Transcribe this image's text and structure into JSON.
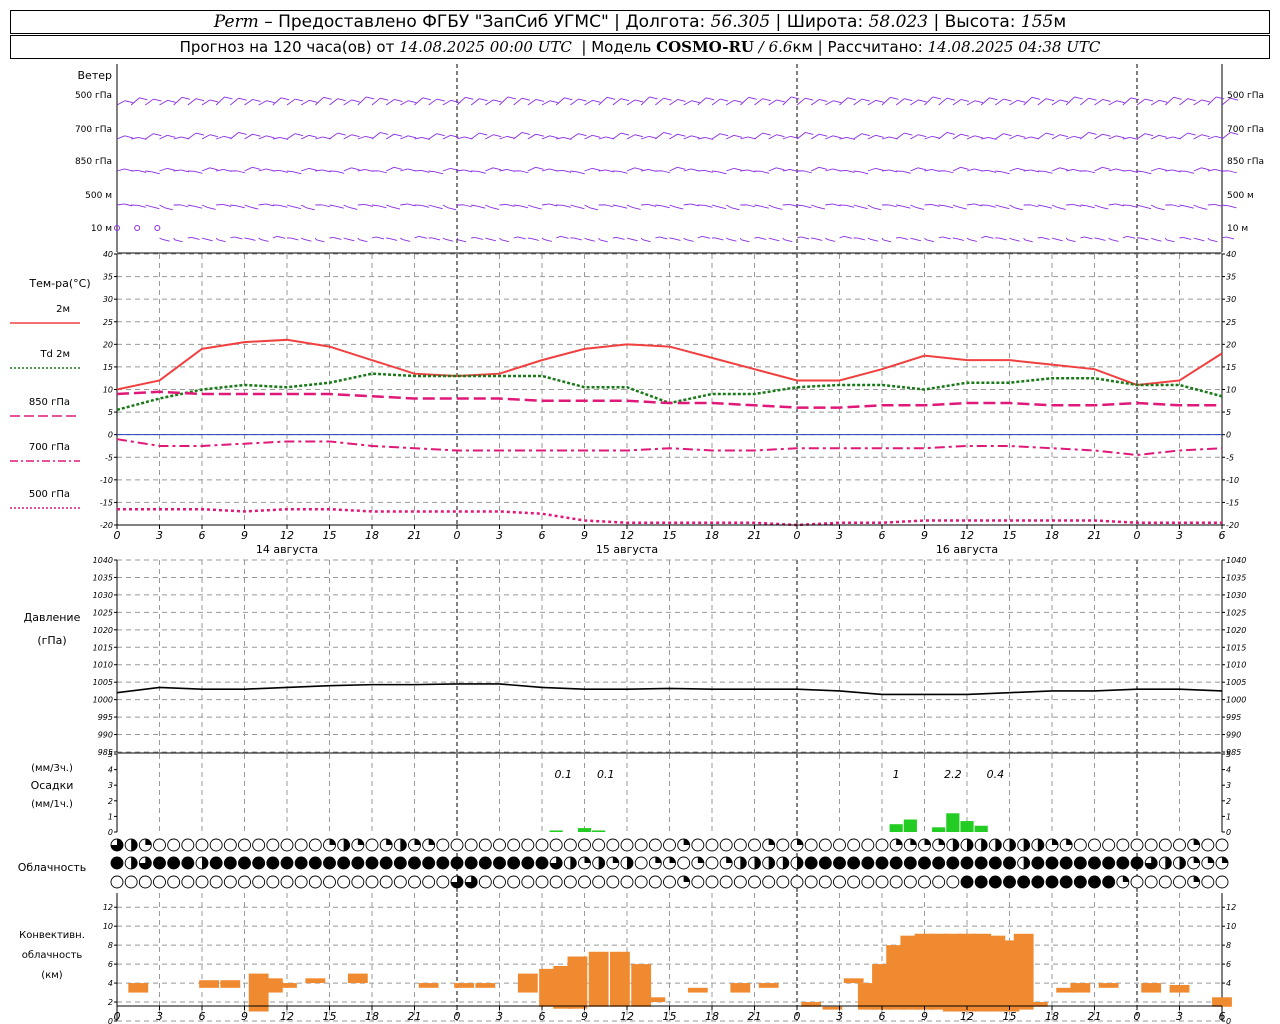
{
  "header": {
    "city": "Perm",
    "provider": "– Предоставлено ФГБУ \"ЗапСиб УГМС\"",
    "lon_label": "Долгота:",
    "lon_value": "56.305",
    "lat_label": "Широта:",
    "lat_value": "58.023",
    "alt_label": "Высота:",
    "alt_value": "155",
    "alt_unit": "м",
    "forecast_label": "Прогноз на 120 часа(ов) от",
    "forecast_start": "14.08.2025 00:00 UTC",
    "model_label": "Модель",
    "model_name": "COSMO-RU",
    "model_res": "/ 6.6",
    "model_res_unit": "км",
    "calc_label": "Рассчитано:",
    "calc_time": "14.08.2025 04:38 UTC"
  },
  "time_axis": {
    "hour_labels": [
      "0",
      "3",
      "6",
      "9",
      "12",
      "15",
      "18",
      "21",
      "0",
      "3",
      "6",
      "9",
      "12",
      "15",
      "18",
      "21",
      "0",
      "3",
      "6",
      "9",
      "12",
      "15",
      "18",
      "21",
      "0",
      "3",
      "6"
    ],
    "day_labels": [
      "14 августа",
      "15 августа",
      "16 августа"
    ]
  },
  "wind_panel": {
    "title": "Ветер",
    "levels": [
      "500 гПа",
      "700 гПа",
      "850 гПа",
      "500 м",
      "10   м"
    ]
  },
  "temperature_panel": {
    "title": "Тем-ра(°С)",
    "legend": [
      {
        "label": "2м",
        "color": "#f04040",
        "dash": "solid"
      },
      {
        "label": "Td 2м",
        "color": "#1a7a1a",
        "dash": "dotted"
      },
      {
        "label": "850 гПа",
        "color": "#e0187a",
        "dash": "long-dash"
      },
      {
        "label": "700 гПа",
        "color": "#e0187a",
        "dash": "dash-dot"
      },
      {
        "label": "500 гПа",
        "color": "#e0187a",
        "dash": "dotted"
      }
    ],
    "yticks": [
      "40",
      "35",
      "30",
      "25",
      "20",
      "15",
      "10",
      "5",
      "0",
      "-5",
      "-10",
      "-15",
      "-20"
    ]
  },
  "pressure_panel": {
    "title_line1": "Давление",
    "title_line2": "(гПа)",
    "yticks": [
      "1040",
      "1035",
      "1030",
      "1025",
      "1020",
      "1015",
      "1010",
      "1005",
      "1000",
      "995",
      "990",
      "985"
    ]
  },
  "precip_panel": {
    "unit_top": "(мм/3ч.)",
    "title": "Осадки",
    "unit_bottom": "(мм/1ч.)",
    "yticks": [
      "5",
      "4",
      "3",
      "2",
      "1",
      "0"
    ],
    "annotations": [
      "0.1",
      "0.1",
      "1",
      "2.2",
      "0.4"
    ]
  },
  "cloud_panel": {
    "title": "Облачность"
  },
  "convective_panel": {
    "title_line1": "Конвективн.",
    "title_line2": "облачность",
    "title_line3": "(км)",
    "yticks": [
      "12",
      "10",
      "8",
      "6",
      "4",
      "2",
      "0"
    ]
  },
  "colors": {
    "wind_barb": "#8a2be2",
    "temp_2m": "#f04040",
    "dewpoint": "#1a7a1a",
    "upper_temp": "#e0187a",
    "precip": "#22cc22",
    "convective": "#f08a30",
    "grid": "#999999"
  },
  "chart_data": [
    {
      "type": "line",
      "title": "Тем-ра(°С)",
      "x_unit": "hours from 14.08.2025 00:00 UTC",
      "x": [
        0,
        3,
        6,
        9,
        12,
        15,
        18,
        21,
        24,
        27,
        30,
        33,
        36,
        39,
        42,
        45,
        48,
        51,
        54,
        57,
        60,
        63,
        66,
        69,
        72,
        75,
        78
      ],
      "ylim": [
        -20,
        40
      ],
      "series": [
        {
          "name": "2м",
          "values": [
            10,
            12,
            19,
            20.5,
            21,
            19.5,
            16.5,
            13.5,
            13,
            13.5,
            16.5,
            19,
            20,
            19.5,
            17,
            14.5,
            12,
            12,
            14.5,
            17.5,
            16.5,
            16.5,
            15.5,
            14.5,
            11,
            12,
            18
          ]
        },
        {
          "name": "Td 2м",
          "values": [
            5.5,
            8,
            10,
            11,
            10.5,
            11.5,
            13.5,
            13,
            13,
            13,
            13,
            10.5,
            10.5,
            7,
            9,
            9,
            10.5,
            11,
            11,
            10,
            11.5,
            11.5,
            12.5,
            12.5,
            11,
            11,
            8.5
          ]
        },
        {
          "name": "850 гПа",
          "values": [
            9,
            9.5,
            9,
            9,
            9,
            9,
            8.5,
            8,
            8,
            8,
            7.5,
            7.5,
            7.5,
            7,
            7,
            6.5,
            6,
            6,
            6.5,
            6.5,
            7,
            7,
            6.5,
            6.5,
            7,
            6.5,
            6.5
          ]
        },
        {
          "name": "700 гПа",
          "values": [
            -1,
            -2.5,
            -2.5,
            -2,
            -1.5,
            -1.5,
            -2.5,
            -3,
            -3.5,
            -3.5,
            -3.5,
            -3.5,
            -3.5,
            -3,
            -3.5,
            -3.5,
            -3,
            -3,
            -3,
            -3,
            -2.5,
            -2.5,
            -3,
            -3.5,
            -4.5,
            -3.5,
            -3
          ]
        },
        {
          "name": "500 гПа",
          "values": [
            -16.5,
            -16.5,
            -16.5,
            -17,
            -16.5,
            -16.5,
            -17,
            -17,
            -17,
            -17,
            -17.5,
            -19,
            -19.5,
            -19.5,
            -19.5,
            -19.5,
            -20,
            -19.5,
            -19.5,
            -19,
            -19,
            -19,
            -19,
            -19,
            -19.5,
            -19.5,
            -19.5
          ]
        }
      ]
    },
    {
      "type": "line",
      "title": "Давление (гПа)",
      "x_unit": "hours from 14.08.2025 00:00 UTC",
      "x": [
        0,
        3,
        6,
        9,
        12,
        15,
        18,
        21,
        24,
        27,
        30,
        33,
        36,
        39,
        42,
        45,
        48,
        51,
        54,
        57,
        60,
        63,
        66,
        69,
        72,
        75,
        78
      ],
      "ylim": [
        985,
        1040
      ],
      "series": [
        {
          "name": "",
          "values": [
            1002,
            1003.5,
            1003,
            1003,
            1003.5,
            1004,
            1004.3,
            1004.3,
            1004.5,
            1004.5,
            1003.5,
            1003,
            1003,
            1003.2,
            1003,
            1003,
            1003,
            1002.5,
            1001.5,
            1001.5,
            1001.5,
            1002,
            1002.5,
            1002.5,
            1003,
            1003,
            1002.5
          ]
        }
      ]
    },
    {
      "type": "bar",
      "title": "Осадки",
      "x_unit": "hours from 14.08.2025 00:00 UTC",
      "ylim": [
        0,
        5
      ],
      "x": [
        31,
        33,
        34,
        55,
        56,
        58,
        59,
        60,
        61
      ],
      "values": [
        0.1,
        0.25,
        0.1,
        0.5,
        0.8,
        0.3,
        1.2,
        0.7,
        0.4
      ]
    },
    {
      "type": "bar",
      "title": "Конвективн. облачность (км)",
      "x_unit": "hours from 14.08.2025 00:00 UTC",
      "ylim": [
        0,
        12
      ],
      "ranges_km": [
        {
          "x": 1.5,
          "base": 3,
          "top": 4
        },
        {
          "x": 6.5,
          "base": 3.5,
          "top": 4.3
        },
        {
          "x": 8,
          "base": 3.5,
          "top": 4.3
        },
        {
          "x": 10,
          "base": 1,
          "top": 5
        },
        {
          "x": 11,
          "base": 3,
          "top": 4.5
        },
        {
          "x": 12,
          "base": 3.5,
          "top": 4
        },
        {
          "x": 14,
          "base": 4,
          "top": 4.5
        },
        {
          "x": 17,
          "base": 4,
          "top": 5
        },
        {
          "x": 22,
          "base": 3.5,
          "top": 4
        },
        {
          "x": 24.5,
          "base": 3.5,
          "top": 4
        },
        {
          "x": 26,
          "base": 3.5,
          "top": 4
        },
        {
          "x": 29,
          "base": 3,
          "top": 5
        },
        {
          "x": 30.5,
          "base": 1.5,
          "top": 5.5
        },
        {
          "x": 31.5,
          "base": 1.3,
          "top": 5.8
        },
        {
          "x": 32.5,
          "base": 1.3,
          "top": 6.8
        },
        {
          "x": 34,
          "base": 1.5,
          "top": 7.3
        },
        {
          "x": 35.5,
          "base": 1.5,
          "top": 7.3
        },
        {
          "x": 37,
          "base": 1.5,
          "top": 6
        },
        {
          "x": 38,
          "base": 2,
          "top": 2.5
        },
        {
          "x": 41,
          "base": 3,
          "top": 3.5
        },
        {
          "x": 44,
          "base": 3,
          "top": 4
        },
        {
          "x": 46,
          "base": 3.5,
          "top": 4
        },
        {
          "x": 49,
          "base": 1.5,
          "top": 2
        },
        {
          "x": 50.5,
          "base": 1.2,
          "top": 1.5
        },
        {
          "x": 52,
          "base": 4,
          "top": 4.5
        },
        {
          "x": 53,
          "base": 1.2,
          "top": 4
        },
        {
          "x": 54,
          "base": 1.2,
          "top": 6
        },
        {
          "x": 55,
          "base": 1.2,
          "top": 8
        },
        {
          "x": 56,
          "base": 1.2,
          "top": 9
        },
        {
          "x": 57,
          "base": 1.2,
          "top": 9.2
        },
        {
          "x": 58,
          "base": 1.2,
          "top": 9.2
        },
        {
          "x": 59,
          "base": 1,
          "top": 9.2
        },
        {
          "x": 60,
          "base": 1,
          "top": 9.2
        },
        {
          "x": 61,
          "base": 1,
          "top": 9.2
        },
        {
          "x": 62,
          "base": 1,
          "top": 9
        },
        {
          "x": 63,
          "base": 1,
          "top": 8.5
        },
        {
          "x": 64,
          "base": 1.2,
          "top": 9.2
        },
        {
          "x": 65,
          "base": 1.5,
          "top": 2
        },
        {
          "x": 67,
          "base": 3,
          "top": 3.5
        },
        {
          "x": 68,
          "base": 3,
          "top": 4
        },
        {
          "x": 70,
          "base": 3.5,
          "top": 4
        },
        {
          "x": 73,
          "base": 3,
          "top": 4
        },
        {
          "x": 75,
          "base": 3,
          "top": 3.8
        },
        {
          "x": 78,
          "base": 1.5,
          "top": 2.5
        }
      ]
    }
  ]
}
